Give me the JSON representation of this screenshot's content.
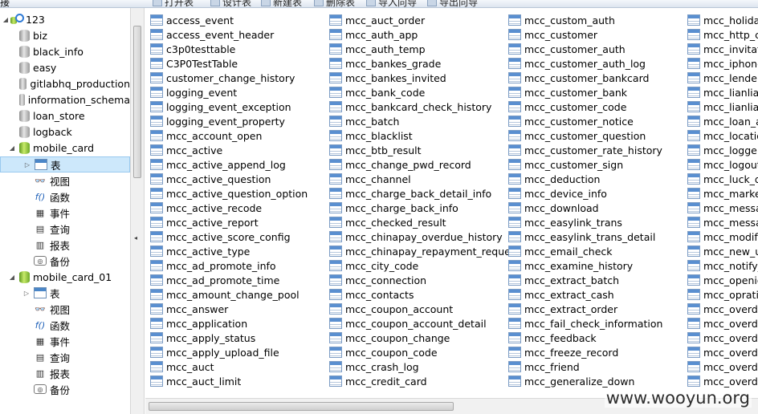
{
  "toolbar": {
    "left_label": "接",
    "buttons": [
      {
        "label": "打开表",
        "icon": "open-table-icon"
      },
      {
        "label": "设计表",
        "icon": "design-table-icon"
      },
      {
        "label": "新建表",
        "icon": "new-table-icon"
      },
      {
        "label": "删除表",
        "icon": "delete-table-icon"
      },
      {
        "label": "导入向导",
        "icon": "import-wizard-icon"
      },
      {
        "label": "导出向导",
        "icon": "export-wizard-icon"
      }
    ]
  },
  "tree": {
    "connection": "123",
    "databases": [
      "biz",
      "black_info",
      "easy",
      "gitlabhq_production",
      "information_schema",
      "loan_store",
      "logback"
    ],
    "open_db_1": {
      "name": "mobile_card",
      "children": [
        "表",
        "视图",
        "函数",
        "事件",
        "查询",
        "报表",
        "备份"
      ],
      "selected": "表"
    },
    "open_db_2": {
      "name": "mobile_card_01",
      "children": [
        "表",
        "视图",
        "函数",
        "事件",
        "查询",
        "报表",
        "备份"
      ]
    }
  },
  "objects": {
    "col1": [
      "access_event",
      "access_event_header",
      "c3p0testtable",
      "C3P0TestTable",
      "customer_change_history",
      "logging_event",
      "logging_event_exception",
      "logging_event_property",
      "mcc_account_open",
      "mcc_active",
      "mcc_active_append_log",
      "mcc_active_question",
      "mcc_active_question_option",
      "mcc_active_recode",
      "mcc_active_report",
      "mcc_active_score_config",
      "mcc_active_type",
      "mcc_ad_promote_info",
      "mcc_ad_promote_time",
      "mcc_amount_change_pool",
      "mcc_answer",
      "mcc_application",
      "mcc_apply_status",
      "mcc_apply_upload_file",
      "mcc_auct",
      "mcc_auct_limit"
    ],
    "col2": [
      "mcc_auct_order",
      "mcc_auth_app",
      "mcc_auth_temp",
      "mcc_bankes_grade",
      "mcc_bankes_invited",
      "mcc_bank_code",
      "mcc_bankcard_check_history",
      "mcc_batch",
      "mcc_blacklist",
      "mcc_btb_result",
      "mcc_change_pwd_record",
      "mcc_channel",
      "mcc_charge_back_detail_info",
      "mcc_charge_back_info",
      "mcc_checked_result",
      "mcc_chinapay_overdue_history",
      "mcc_chinapay_repayment_request",
      "mcc_city_code",
      "mcc_connection",
      "mcc_contacts",
      "mcc_coupon_account",
      "mcc_coupon_account_detail",
      "mcc_coupon_change",
      "mcc_coupon_code",
      "mcc_crash_log",
      "mcc_credit_card"
    ],
    "col3": [
      "mcc_custom_auth",
      "mcc_customer",
      "mcc_customer_auth",
      "mcc_customer_auth_log",
      "mcc_customer_bankcard",
      "mcc_customer_bank",
      "mcc_customer_code",
      "mcc_customer_notice",
      "mcc_customer_question",
      "mcc_customer_rate_history",
      "mcc_customer_sign",
      "mcc_deduction",
      "mcc_device_info",
      "mcc_download",
      "mcc_easylink_trans",
      "mcc_easylink_trans_detail",
      "mcc_email_check",
      "mcc_examine_history",
      "mcc_extract_batch",
      "mcc_extract_cash",
      "mcc_extract_order",
      "mcc_fail_check_information",
      "mcc_feedback",
      "mcc_freeze_record",
      "mcc_friend",
      "mcc_generalize_down"
    ],
    "col4": [
      "mcc_holida",
      "mcc_http_c",
      "mcc_invitat",
      "mcc_iphone",
      "mcc_lender",
      "mcc_lianlian",
      "mcc_lianlian",
      "mcc_loan_a",
      "mcc_locatio",
      "mcc_logger",
      "mcc_logout",
      "mcc_luck_d",
      "mcc_market",
      "mcc_messa",
      "mcc_messa",
      "mcc_modif",
      "mcc_new_u",
      "mcc_notify_",
      "mcc_openio",
      "mcc_oprati",
      "mcc_overd",
      "mcc_overd",
      "mcc_overd",
      "mcc_overd",
      "mcc_overd",
      "mcc_overd"
    ]
  },
  "watermark": "www.wooyun.org"
}
